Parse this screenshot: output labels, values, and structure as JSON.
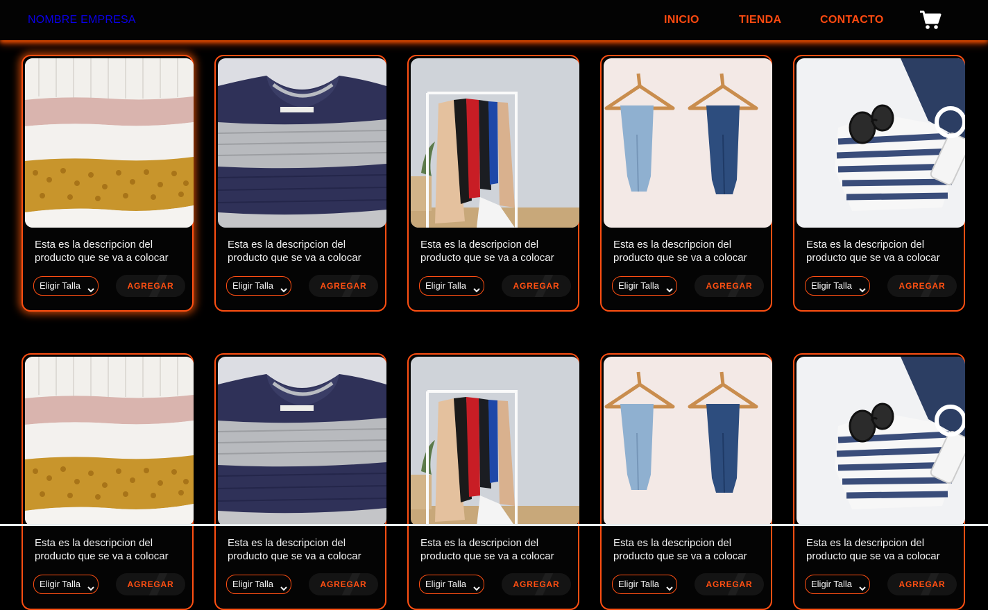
{
  "navbar": {
    "brand": "NOMBRE EMPRESA",
    "links": [
      "INICIO",
      "TIENDA",
      "CONTACTO"
    ],
    "cart_icon": "shopping-cart-icon",
    "brand_color": "#0b00e8",
    "accent_color": "#ff4f12"
  },
  "product": {
    "description": "Esta es la descripcion del producto que se va a colocar",
    "size_select_value": "Eligir Talla",
    "add_label": "AGREGAR"
  },
  "cards": [
    {
      "photo": "folded-sweaters"
    },
    {
      "photo": "striped-sweater"
    },
    {
      "photo": "clothes-rack"
    },
    {
      "photo": "jeans-on-hangers"
    },
    {
      "photo": "striped-shirt-sunglasses"
    },
    {
      "photo": "folded-sweaters"
    },
    {
      "photo": "striped-sweater"
    },
    {
      "photo": "clothes-rack"
    },
    {
      "photo": "jeans-on-hangers"
    },
    {
      "photo": "striped-shirt-sunglasses"
    }
  ]
}
